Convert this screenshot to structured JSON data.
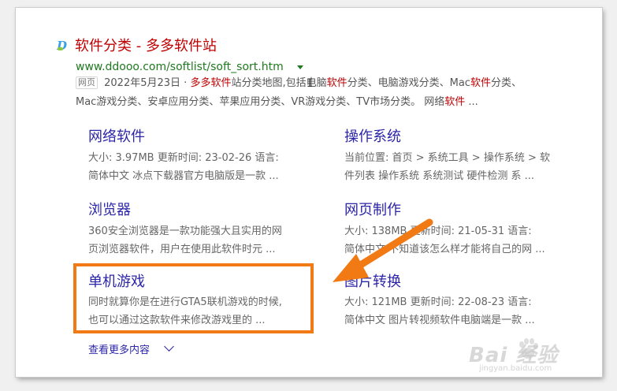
{
  "result": {
    "logo_letter": "D",
    "title": "软件分类 - 多多软件站",
    "url": "www.ddooo.com/softlist/soft_sort.htm",
    "tag": "网页",
    "snippet_date_part": " 2022年5月23日 · ",
    "snippet_l1": [
      {
        "t": "多多软件",
        "em": true
      },
      {
        "t": "站分类地图,包括电脑",
        "em": false
      },
      {
        "t": "软件",
        "em": true
      },
      {
        "t": "分类、电脑游戏分类、Mac",
        "em": false
      },
      {
        "t": "软件",
        "em": true
      },
      {
        "t": "分类、",
        "em": false
      }
    ],
    "snippet_l2": [
      {
        "t": "Mac游戏分类、安卓应用分类、苹果应用分类、VR游戏分类、TV市场分类。 网络",
        "em": false
      },
      {
        "t": "软件",
        "em": true
      },
      {
        "t": " ...",
        "em": false
      }
    ]
  },
  "categories": [
    {
      "title": "网络软件",
      "line1": "大小: 3.97MB 更新时间: 23-02-26 语言:",
      "line2": "简体中文 冰点下载器官方电脑版是一款 ..."
    },
    {
      "title": "操作系统",
      "line1": "当前位置: 首页 > 系统工具 > 操作系统 > 软",
      "line2": "件列表 操作系统 系统测试 硬件检测 系 ..."
    },
    {
      "title": "浏览器",
      "line1": "360安全浏览器是一款功能强大且实用的网",
      "line2": "页浏览器软件，用户在使用此软件时元 ..."
    },
    {
      "title": "网页制作",
      "line1": "大小: 138MB 更新时间: 21-05-31 语言:",
      "line2": "简体中文 不知道该怎么样才能将自己的网 ..."
    },
    {
      "title": "单机游戏",
      "line1": "同时就算你是在进行GTA5联机游戏的时候,",
      "line2": "也可以通过这款软件来修改游戏里的 ..."
    },
    {
      "title": "图片转换",
      "line1": "大小: 121MB 更新时间: 22-08-23 语言:",
      "line2": "简体中文 图片转视频软件电脑端是一款 ..."
    }
  ],
  "more_label": "查看更多内容",
  "watermark": {
    "text": "Bai  经验",
    "sub": "jingyan.baidu.com"
  },
  "colors": {
    "title_red": "#c00000",
    "link_purple": "#2c25a8",
    "url_green": "#1f7a1f",
    "annotation_orange": "#f27a14"
  },
  "icons": [
    "site-logo-icon",
    "dropdown-arrow-icon",
    "text-cursor-icon",
    "chevron-down-icon",
    "orange-arrow-icon",
    "baidu-paw-icon"
  ]
}
